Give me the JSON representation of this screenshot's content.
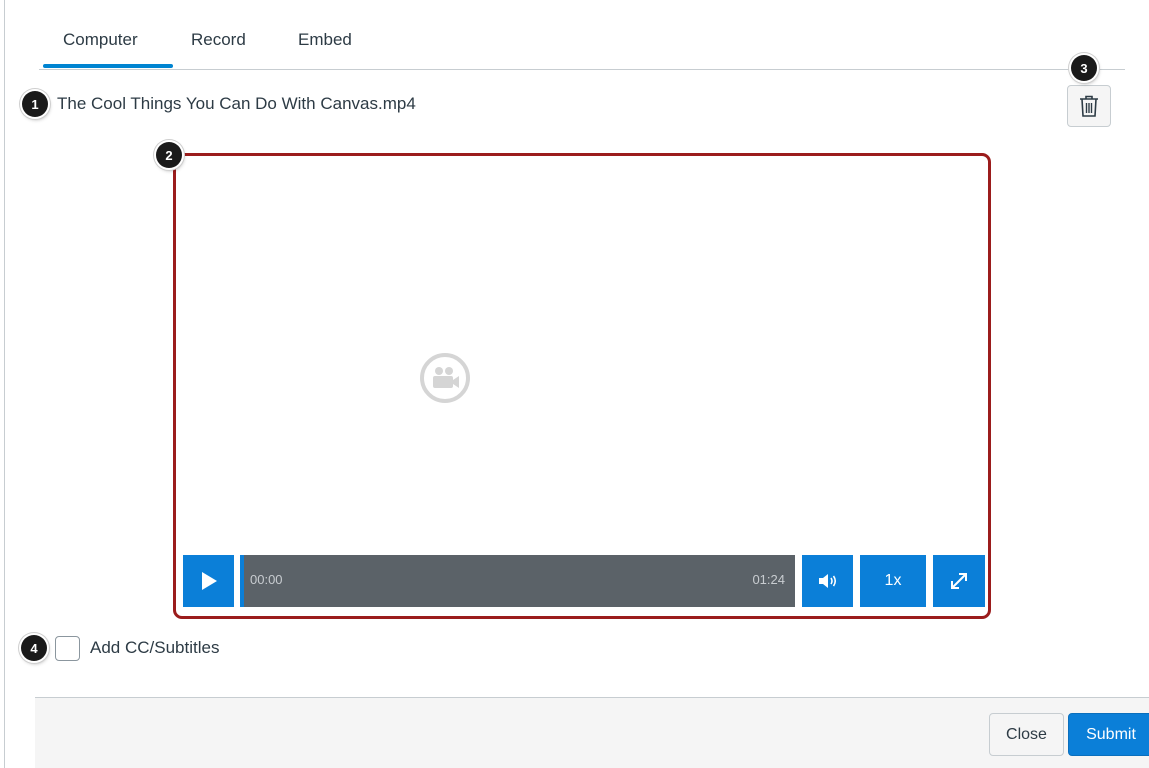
{
  "tabs": [
    {
      "label": "Computer",
      "active": true
    },
    {
      "label": "Record",
      "active": false
    },
    {
      "label": "Embed",
      "active": false
    }
  ],
  "file": {
    "name": "The Cool Things You Can Do With Canvas.mp4"
  },
  "player": {
    "current_time": "00:00",
    "duration": "01:24",
    "speed": "1x",
    "progress": 0
  },
  "captions": {
    "label": "Add CC/Subtitles",
    "checked": false
  },
  "footer": {
    "close_label": "Close",
    "submit_label": "Submit"
  },
  "callouts": [
    "1",
    "2",
    "3",
    "4"
  ],
  "colors": {
    "accent": "#0b7fd8",
    "highlight_outline": "#9b1c1c",
    "timeline": "#5b6268"
  },
  "icons": {
    "delete": "trash-icon",
    "play": "play-icon",
    "volume": "volume-icon",
    "fullscreen": "fullscreen-icon",
    "placeholder": "video-camera-icon"
  }
}
